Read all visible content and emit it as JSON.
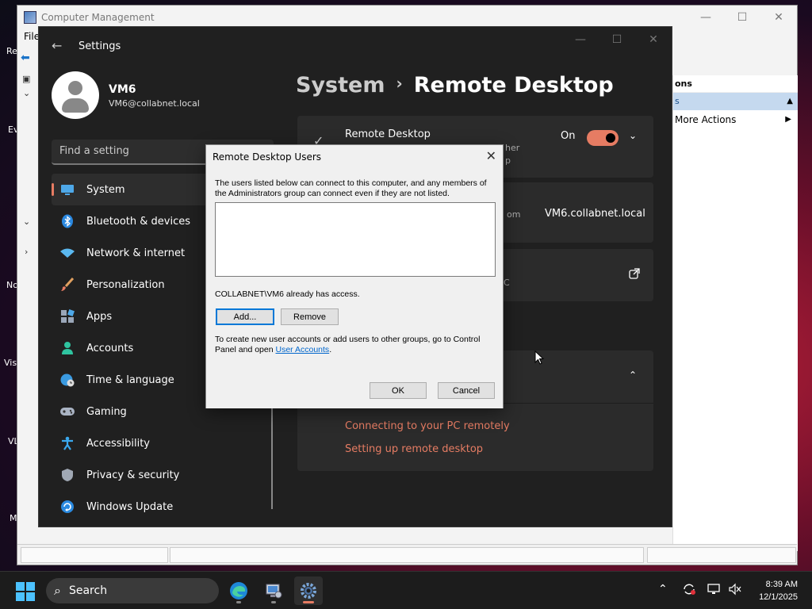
{
  "desktop": {
    "icon_labels": [
      "Re",
      "Ev",
      "No",
      "Vis",
      "VL",
      "M"
    ]
  },
  "computer_management": {
    "title": "Computer Management",
    "menu_first": "File",
    "actions_header": "ons",
    "actions_selected": "s",
    "more_actions": "More Actions"
  },
  "settings": {
    "title": "Settings",
    "user": {
      "name": "VM6",
      "email": "VM6@collabnet.local"
    },
    "search_placeholder": "Find a setting",
    "nav": [
      {
        "label": "System",
        "icon": "monitor-icon"
      },
      {
        "label": "Bluetooth & devices",
        "icon": "bluetooth-icon"
      },
      {
        "label": "Network & internet",
        "icon": "wifi-icon"
      },
      {
        "label": "Personalization",
        "icon": "brush-icon"
      },
      {
        "label": "Apps",
        "icon": "apps-icon"
      },
      {
        "label": "Accounts",
        "icon": "person-icon"
      },
      {
        "label": "Time & language",
        "icon": "globe-clock-icon"
      },
      {
        "label": "Gaming",
        "icon": "gamepad-icon"
      },
      {
        "label": "Accessibility",
        "icon": "accessibility-icon"
      },
      {
        "label": "Privacy & security",
        "icon": "shield-icon"
      },
      {
        "label": "Windows Update",
        "icon": "update-icon"
      }
    ],
    "breadcrumb": {
      "parent": "System",
      "separator": "›",
      "current": "Remote Desktop"
    },
    "remote_desktop_card": {
      "title": "Remote Desktop",
      "frag1": "her",
      "frag2": "p",
      "state": "On"
    },
    "pc_name_card": {
      "frag": "om",
      "value": "VM6.collabnet.local"
    },
    "users_card": {
      "frag": "C"
    },
    "related": {
      "links": [
        "Connecting to your PC remotely",
        "Setting up remote desktop"
      ]
    }
  },
  "dialog": {
    "title": "Remote Desktop Users",
    "close": "✕",
    "intro_line1": "The users listed below can connect to this computer, and any members of",
    "intro_line2": "the Administrators group can connect even if they are not listed.",
    "access_note": "COLLABNET\\VM6 already has access.",
    "add_label": "Add...",
    "remove_label": "Remove",
    "footer_line1": "To create new user accounts or add users to other groups, go to Control",
    "footer_line2_prefix": "Panel and open ",
    "footer_link": "User Accounts",
    "footer_suffix": ".",
    "ok_label": "OK",
    "cancel_label": "Cancel"
  },
  "taskbar": {
    "search_label": "Search",
    "time": "8:39 AM",
    "date": "12/1/2025"
  }
}
